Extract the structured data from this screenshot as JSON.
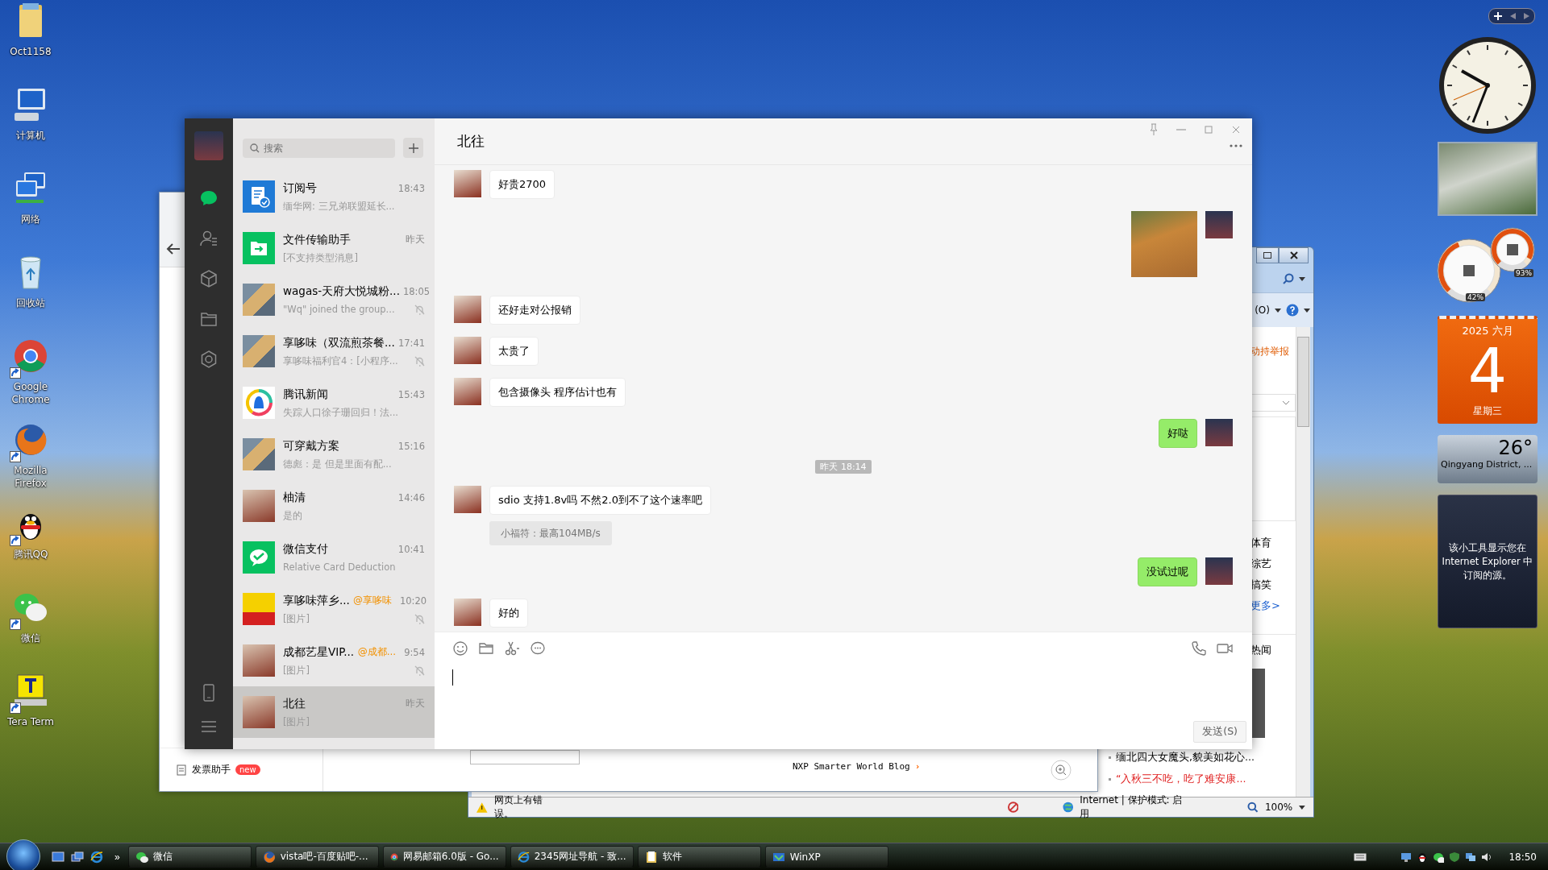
{
  "desktop_icons": [
    {
      "label": "Oct1158",
      "kind": "folder",
      "shortcut": false
    },
    {
      "label": "计算机",
      "kind": "computer",
      "shortcut": false
    },
    {
      "label": "网络",
      "kind": "network",
      "shortcut": false
    },
    {
      "label": "回收站",
      "kind": "recycle",
      "shortcut": false
    },
    {
      "label": "Google Chrome",
      "kind": "chrome",
      "shortcut": true
    },
    {
      "label": "Mozilla Firefox",
      "kind": "firefox",
      "shortcut": true
    },
    {
      "label": "腾讯QQ",
      "kind": "qq",
      "shortcut": true
    },
    {
      "label": "微信",
      "kind": "wechat",
      "shortcut": true
    },
    {
      "label": "Tera Term",
      "kind": "terminal",
      "shortcut": true
    }
  ],
  "browser_window": {
    "sidebar_link": {
      "label": "发票助手",
      "badge": "new"
    },
    "blog_link": "NXP Smarter World Blog",
    "blog_arrow": "›"
  },
  "ie_window": {
    "command_label": "(O)",
    "report_link": "动持举报",
    "channels": [
      "体育",
      "综艺",
      "搞笑"
    ],
    "more_link": "更多>",
    "section_title": "热闻",
    "headlines": [
      {
        "text": "缅北四大女魔头,貌美如花心...",
        "kind": "normal"
      },
      {
        "text": "“入秋三不吃，吃了难安康...",
        "kind": "highlight"
      }
    ],
    "status_bar": {
      "error": "网页上有错误。",
      "zone": "Internet | 保护模式: 启用",
      "zoom": "100%"
    }
  },
  "wechat": {
    "title": "北往",
    "search": {
      "placeholder": "搜索"
    },
    "sidebar": [
      {
        "kind": "chat",
        "selected": true
      },
      {
        "kind": "contacts",
        "selected": false
      },
      {
        "kind": "cube",
        "selected": false
      },
      {
        "kind": "folder",
        "selected": false
      },
      {
        "kind": "moments",
        "selected": false
      }
    ],
    "chats": [
      {
        "name": "订阅号",
        "time": "18:43",
        "preview": "缅华网: 三兄弟联盟延长...",
        "muted": false,
        "selected": false
      },
      {
        "name": "文件传输助手",
        "time": "昨天",
        "preview": "[不支持类型消息]",
        "muted": false,
        "selected": false
      },
      {
        "name": "wagas-天府大悦城粉...",
        "time": "18:05",
        "preview": "\"Wq\" joined the group...",
        "muted": true,
        "selected": false
      },
      {
        "name": "享哆味（双流煎茶餐...",
        "time": "17:41",
        "preview": "享哆味福利官4：[小程序...",
        "muted": true,
        "selected": false
      },
      {
        "name": "腾讯新闻",
        "time": "15:43",
        "preview": "失踪人口徐子珊回归！法...",
        "muted": false,
        "selected": false
      },
      {
        "name": "可穿戴方案",
        "time": "15:16",
        "preview": "德彪：是  但是里面有配...",
        "muted": false,
        "selected": false
      },
      {
        "name": "柚清",
        "time": "14:46",
        "preview": "是的",
        "muted": false,
        "selected": false
      },
      {
        "name": "微信支付",
        "time": "10:41",
        "preview": "Relative Card Deduction",
        "muted": false,
        "selected": false
      },
      {
        "name": "享哆味萍乡...",
        "mention": "@享哆味",
        "time": "10:20",
        "preview": "[图片]",
        "muted": true,
        "selected": false
      },
      {
        "name": "成都艺星VIP...",
        "mention": "@成都...",
        "time": "9:54",
        "preview": "[图片]",
        "muted": true,
        "selected": false
      },
      {
        "name": "北往",
        "time": "昨天",
        "preview": "[图片]",
        "muted": false,
        "selected": true
      }
    ],
    "messages": [
      {
        "kind": "text",
        "outgoing": false,
        "text": "好贵2700"
      },
      {
        "kind": "image",
        "outgoing": true
      },
      {
        "kind": "text",
        "outgoing": false,
        "text": "还好走对公报销"
      },
      {
        "kind": "text",
        "outgoing": false,
        "text": "太贵了"
      },
      {
        "kind": "text",
        "outgoing": false,
        "text": "包含摄像头  程序估计也有"
      },
      {
        "kind": "text",
        "outgoing": true,
        "text": "好哒"
      },
      {
        "kind": "time",
        "text": "昨天 18:14"
      },
      {
        "kind": "text",
        "outgoing": false,
        "text": "sdio 支持1.8v吗 不然2.0到不了这个速率吧",
        "quote": "小福符：最高104MB/s"
      },
      {
        "kind": "text",
        "outgoing": true,
        "text": "没试过呢"
      },
      {
        "kind": "text",
        "outgoing": false,
        "text": "好的"
      }
    ],
    "send_button": "发送(S)"
  },
  "gadgets": {
    "cpu_meter": {
      "gauges": [
        {
          "reading": "42%",
          "level": 0.42
        },
        {
          "reading": "93%",
          "level": 0.93
        }
      ]
    },
    "calendar": {
      "year_month": "2025 六月",
      "day": "4",
      "weekday": "星期三"
    },
    "weather": {
      "temperature": "26°",
      "place": "Qingyang District, ..."
    },
    "feed": {
      "message": "该小工具显示您在 Internet Explorer 中订阅的源。"
    }
  },
  "taskbar": {
    "overflow": "»",
    "tasks": [
      {
        "label": "微信"
      },
      {
        "label": "vista吧-百度贴吧-..."
      },
      {
        "label": "网易邮箱6.0版 - Go..."
      },
      {
        "label": "2345网址导航 - 致..."
      },
      {
        "label": "软件"
      },
      {
        "label": "WinXP"
      }
    ],
    "clock": "18:50"
  }
}
